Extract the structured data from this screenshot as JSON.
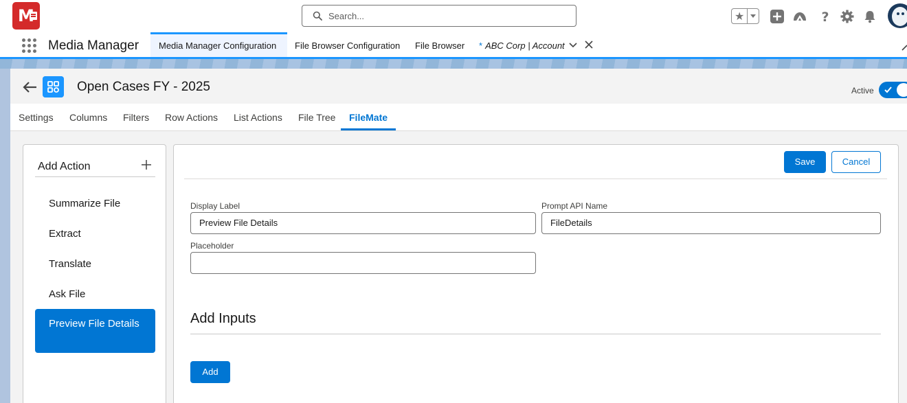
{
  "global_header": {
    "logo_text": "M",
    "search": {
      "placeholder": "Search..."
    },
    "icons": [
      "favorites-star-icon",
      "chevron-down-icon",
      "add-icon",
      "trailhead-icon",
      "help-icon",
      "setup-gear-icon",
      "notification-bell-icon",
      "user-avatar"
    ]
  },
  "nav": {
    "app_name": "Media Manager",
    "tabs": [
      {
        "label": "Media Manager Configuration",
        "active": true
      },
      {
        "label": "File Browser Configuration",
        "active": false
      },
      {
        "label": "File Browser",
        "active": false
      },
      {
        "label": "ABC Corp | Account",
        "active": false,
        "unsaved_marker": "*"
      }
    ]
  },
  "record": {
    "title": "Open Cases FY - 2025",
    "active_label": "Active",
    "active": true
  },
  "tabs": [
    {
      "label": "Settings",
      "active": false
    },
    {
      "label": "Columns",
      "active": false
    },
    {
      "label": "Filters",
      "active": false
    },
    {
      "label": "Row Actions",
      "active": false
    },
    {
      "label": "List Actions",
      "active": false
    },
    {
      "label": "File Tree",
      "active": false
    },
    {
      "label": "FileMate",
      "active": true
    }
  ],
  "sidebar": {
    "title": "Add Action",
    "items": [
      {
        "label": "Summarize File",
        "active": false
      },
      {
        "label": "Extract",
        "active": false
      },
      {
        "label": "Translate",
        "active": false
      },
      {
        "label": "Ask File",
        "active": false
      },
      {
        "label": "Preview File Details",
        "active": true
      }
    ]
  },
  "form": {
    "save_label": "Save",
    "cancel_label": "Cancel",
    "display_label": {
      "label": "Display Label",
      "value": "Preview File Details"
    },
    "prompt_api_name": {
      "label": "Prompt API Name",
      "value": "FileDetails"
    },
    "placeholder": {
      "label": "Placeholder",
      "value": ""
    },
    "inputs_section_title": "Add Inputs",
    "add_label": "Add"
  },
  "colors": {
    "brand_blue": "#0176d3",
    "logo_red": "#d42a2a",
    "nav_accent": "#1b96ff"
  }
}
